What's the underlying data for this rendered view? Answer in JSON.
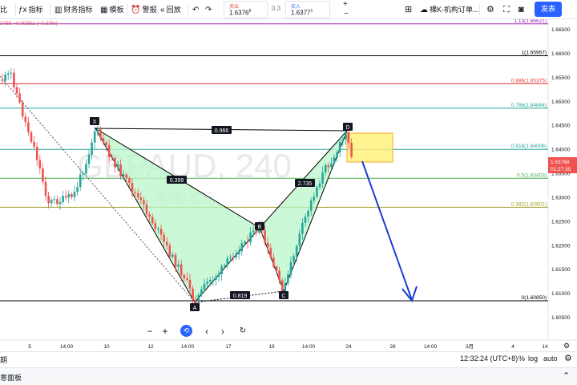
{
  "toolbar": {
    "left_cut": "比",
    "indicators": "指标",
    "financials": "财务指标",
    "templates": "模板",
    "alert": "警报",
    "replay": "回放",
    "sell_label": "卖出",
    "sell_price": "1.6376",
    "sell_sup": "8",
    "spread": "0.3",
    "buy_label": "买入",
    "buy_price": "1.6377",
    "buy_sup": "1",
    "layout_name": "裸K-机构订单...",
    "publish": "发表"
  },
  "header_info": "3768  −0.00051 (−0.03%)",
  "price_axis": {
    "ticks": [
      "1.66500",
      "1.66000",
      "1.65500",
      "1.65000",
      "1.64500",
      "1.64000",
      "1.63500",
      "1.63000",
      "1.62500",
      "1.62000",
      "1.61500",
      "1.61000",
      "1.60500"
    ],
    "current_price": "1.63768",
    "countdown": "01:27:35"
  },
  "time_axis": {
    "ticks": [
      "5",
      "14:00",
      "10",
      "12",
      "14:00",
      "17",
      "19",
      "14:00",
      "24",
      "26",
      "14:00",
      "3月",
      "4",
      "14"
    ]
  },
  "fib_levels": [
    {
      "label": "1.13(1.66621)",
      "color": "#9c27b0"
    },
    {
      "label": "1(1.65957)",
      "color": "#000000"
    },
    {
      "label": "0.886(1.65375)",
      "color": "#e53935"
    },
    {
      "label": "0.786(1.64864)",
      "color": "#26a69a"
    },
    {
      "label": "0.618(1.64006)",
      "color": "#26a69a"
    },
    {
      "label": "0.5(1.63403)",
      "color": "#4caf50"
    },
    {
      "label": "0.382(1.62801)",
      "color": "#9e9d24"
    },
    {
      "label": "0(1.60850)",
      "color": "#000000"
    }
  ],
  "pattern": {
    "points": [
      "X",
      "A",
      "B",
      "C",
      "D"
    ],
    "ratios": {
      "xd": "0.966",
      "xb": "0.399",
      "bd": "2.735",
      "ac": "0.819"
    }
  },
  "watermark": {
    "symbol": "GBPAUD, 240",
    "subtitle": "英镑/澳元"
  },
  "bottom": {
    "left_cut": "期",
    "time": "12:32:24 (UTC+8)",
    "percent": "%",
    "log": "log",
    "auto": "auto"
  },
  "panel": {
    "label": "意面板"
  },
  "colors": {
    "accent": "#2962ff",
    "bull": "#26a69a",
    "bear": "#ef5350",
    "pattern_fill": "#b9f6ca",
    "prz": "#fff176"
  }
}
